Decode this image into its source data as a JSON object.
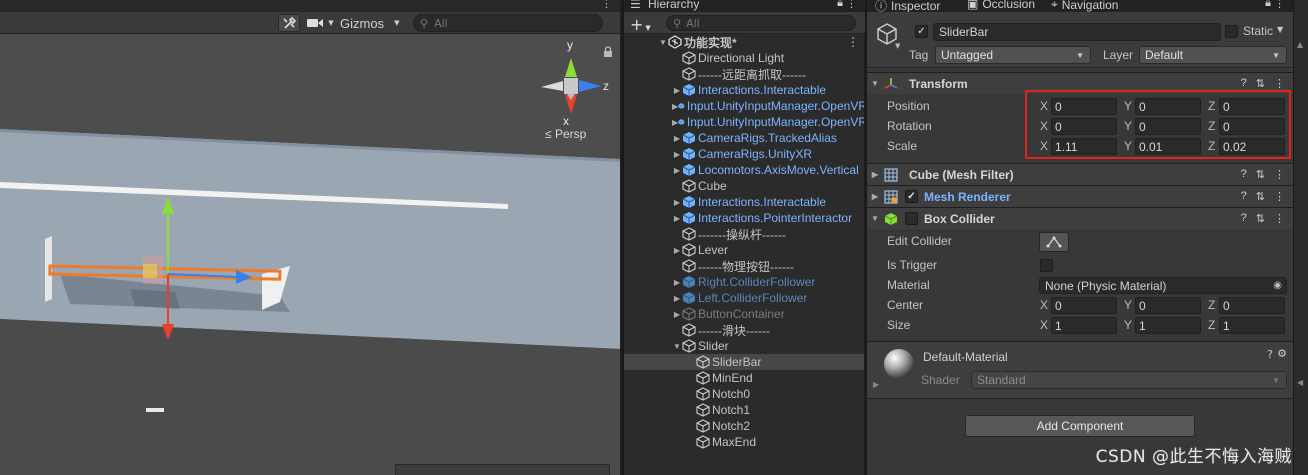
{
  "scene": {
    "gizmos_label": "Gizmos",
    "search_placeholder": "All",
    "persp_label": "Persp",
    "axis_labels": {
      "y": "y",
      "z": "z",
      "x": "x"
    }
  },
  "hierarchy": {
    "tab_title": "Hierarchy",
    "add_label": "+",
    "search_placeholder": "All",
    "rows": [
      {
        "label": "功能实现*",
        "indent": 0,
        "style": "scene-root",
        "arrow": "▼"
      },
      {
        "label": "Directional Light",
        "indent": 1,
        "style": "normal",
        "arrow": ""
      },
      {
        "label": "------远距离抓取------",
        "indent": 1,
        "style": "normal",
        "arrow": ""
      },
      {
        "label": "Interactions.Interactable",
        "indent": 1,
        "style": "prefab",
        "arrow": "▶"
      },
      {
        "label": "Input.UnityInputManager.OpenVR",
        "indent": 1,
        "style": "prefab",
        "arrow": "▶"
      },
      {
        "label": "Input.UnityInputManager.OpenVR",
        "indent": 1,
        "style": "prefab",
        "arrow": "▶"
      },
      {
        "label": "CameraRigs.TrackedAlias",
        "indent": 1,
        "style": "prefab",
        "arrow": "▶"
      },
      {
        "label": "CameraRigs.UnityXR",
        "indent": 1,
        "style": "prefab",
        "arrow": "▶"
      },
      {
        "label": "Locomotors.AxisMove.Vertical",
        "indent": 1,
        "style": "prefab",
        "arrow": "▶"
      },
      {
        "label": "Cube",
        "indent": 1,
        "style": "normal",
        "arrow": ""
      },
      {
        "label": "Interactions.Interactable",
        "indent": 1,
        "style": "prefab",
        "arrow": "▶"
      },
      {
        "label": "Interactions.PointerInteractor",
        "indent": 1,
        "style": "prefab",
        "arrow": "▶"
      },
      {
        "label": "-------操纵杆------",
        "indent": 1,
        "style": "normal",
        "arrow": ""
      },
      {
        "label": "Lever",
        "indent": 1,
        "style": "normal",
        "arrow": "▶"
      },
      {
        "label": "------物理按钮------",
        "indent": 1,
        "style": "normal",
        "arrow": ""
      },
      {
        "label": "Right.ColliderFollower",
        "indent": 1,
        "style": "prefab-dim",
        "arrow": "▶"
      },
      {
        "label": "Left.ColliderFollower",
        "indent": 1,
        "style": "prefab-dim",
        "arrow": "▶"
      },
      {
        "label": "ButtonContainer",
        "indent": 1,
        "style": "inactive",
        "arrow": "▶"
      },
      {
        "label": "------滑块------",
        "indent": 1,
        "style": "normal",
        "arrow": ""
      },
      {
        "label": "Slider",
        "indent": 1,
        "style": "normal",
        "arrow": "▼"
      },
      {
        "label": "SliderBar",
        "indent": 2,
        "style": "selected",
        "arrow": ""
      },
      {
        "label": "MinEnd",
        "indent": 2,
        "style": "normal",
        "arrow": ""
      },
      {
        "label": "Notch0",
        "indent": 2,
        "style": "normal",
        "arrow": ""
      },
      {
        "label": "Notch1",
        "indent": 2,
        "style": "normal",
        "arrow": ""
      },
      {
        "label": "Notch2",
        "indent": 2,
        "style": "normal",
        "arrow": ""
      },
      {
        "label": "MaxEnd",
        "indent": 2,
        "style": "normal",
        "arrow": ""
      }
    ]
  },
  "inspector": {
    "tabs": [
      "Inspector",
      "Occlusion",
      "Navigation"
    ],
    "object_name": "SliderBar",
    "static_label": "Static",
    "tag_label": "Tag",
    "tag_value": "Untagged",
    "layer_label": "Layer",
    "layer_value": "Default",
    "transform": {
      "title": "Transform",
      "position": {
        "label": "Position",
        "x": "0",
        "y": "0",
        "z": "0"
      },
      "rotation": {
        "label": "Rotation",
        "x": "0",
        "y": "0",
        "z": "0"
      },
      "scale": {
        "label": "Scale",
        "x": "1.11",
        "y": "0.01",
        "z": "0.02"
      }
    },
    "mesh_filter_title": "Cube (Mesh Filter)",
    "mesh_renderer_title": "Mesh Renderer",
    "box_collider": {
      "title": "Box Collider",
      "edit_collider_label": "Edit Collider",
      "is_trigger_label": "Is Trigger",
      "material_label": "Material",
      "material_value": "None (Physic Material)",
      "center": {
        "label": "Center",
        "x": "0",
        "y": "0",
        "z": "0"
      },
      "size": {
        "label": "Size",
        "x": "1",
        "y": "1",
        "z": "1"
      }
    },
    "material": {
      "name": "Default-Material",
      "shader_label": "Shader",
      "shader_value": "Standard"
    },
    "add_component_label": "Add Component",
    "axis_x": "X",
    "axis_y": "Y",
    "axis_z": "Z"
  },
  "watermark": "CSDN @此生不悔入海贼",
  "colors": {
    "highlight": "#e0241b",
    "prefab_text": "#7cb4ff",
    "selected_row": "#474747"
  }
}
